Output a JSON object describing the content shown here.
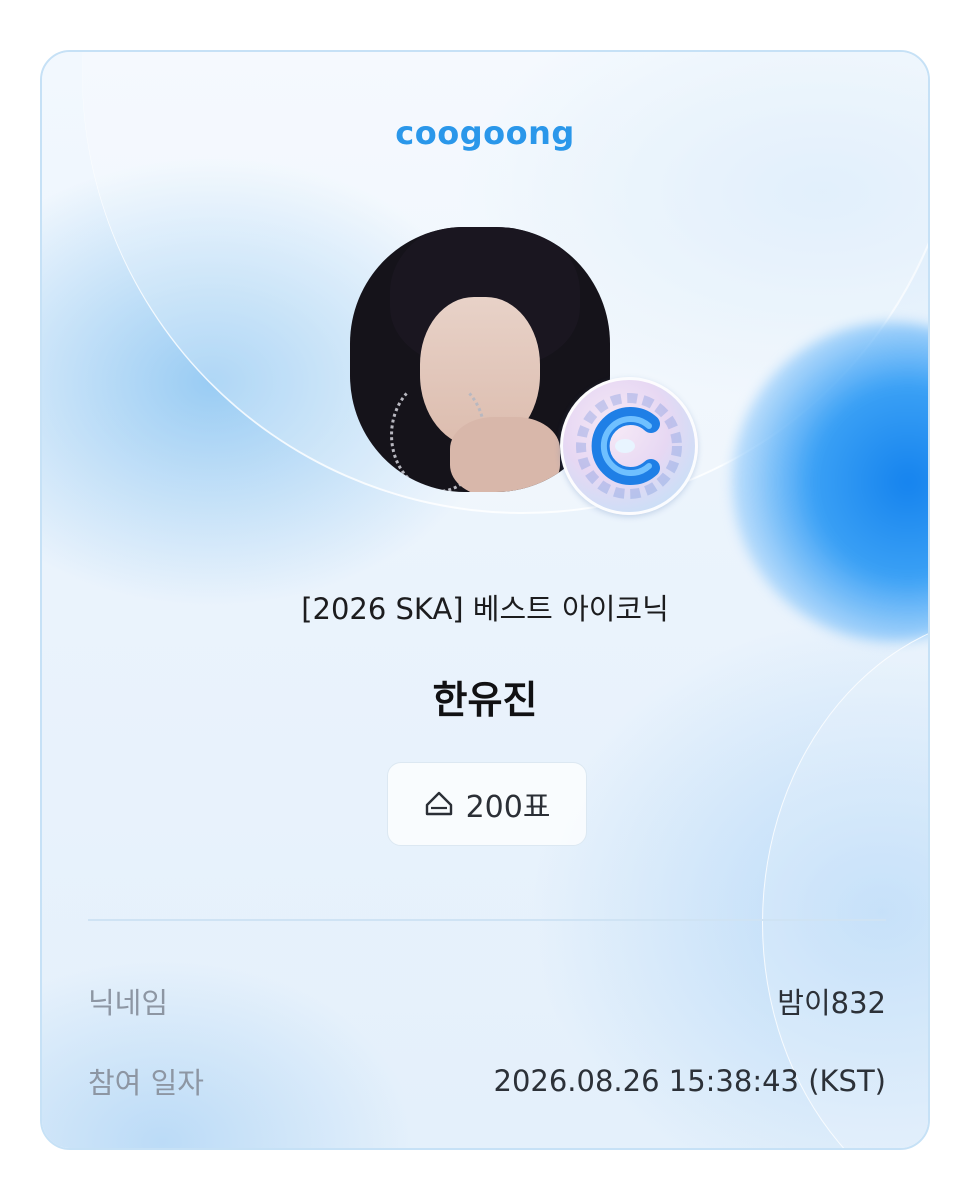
{
  "brand": {
    "logo_text": "coogoong",
    "color": "#2a97ea"
  },
  "vote": {
    "category": "[2026 SKA] 베스트 아이코닉",
    "candidate_name": "한유진",
    "vote_count": "200표",
    "vote_icon": "ticket-icon"
  },
  "details": {
    "nickname_label": "닉네임",
    "nickname_value": "밤이832",
    "date_label": "참여 일자",
    "date_value": "2026.08.26 15:38:43 (KST)"
  },
  "colors": {
    "accent": "#2a97ea",
    "orb": "#1583ee",
    "label_gray": "#8d96a3"
  }
}
